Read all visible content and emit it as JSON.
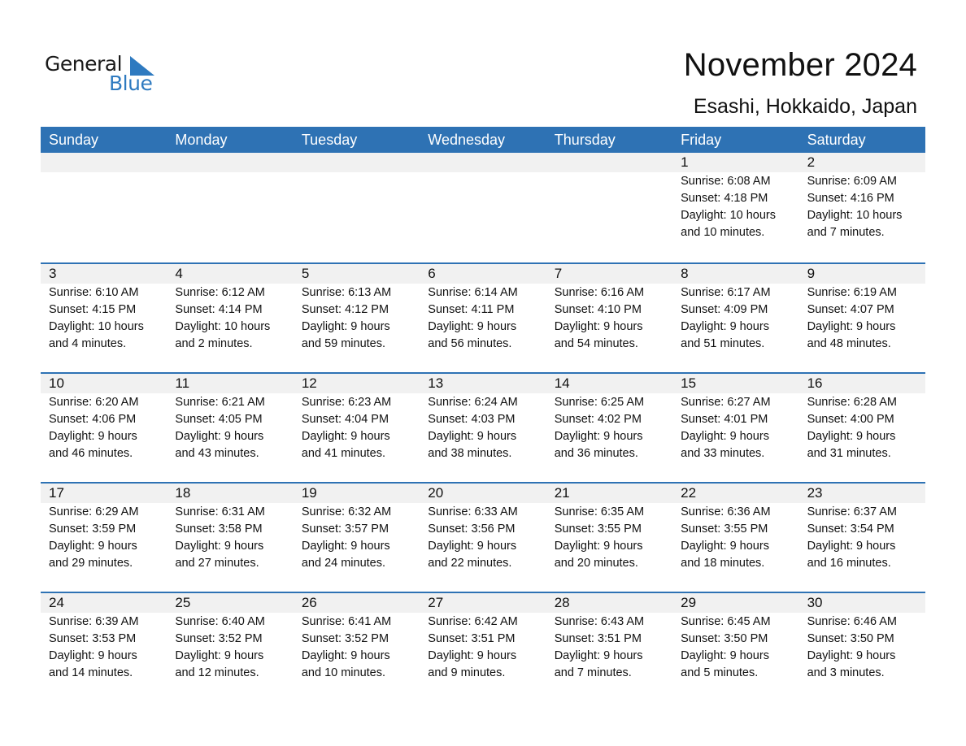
{
  "logo": {
    "line1": "General",
    "line2": "Blue",
    "icon": "triangle-flag-icon",
    "brand_color": "#2e7ac0"
  },
  "header": {
    "title": "November 2024",
    "location": "Esashi, Hokkaido, Japan"
  },
  "colors": {
    "header_bg": "#2e72b4",
    "date_band_bg": "#f1f1f1"
  },
  "weekdays": [
    "Sunday",
    "Monday",
    "Tuesday",
    "Wednesday",
    "Thursday",
    "Friday",
    "Saturday"
  ],
  "weeks": [
    [
      null,
      null,
      null,
      null,
      null,
      {
        "day": "1",
        "sunrise": "Sunrise: 6:08 AM",
        "sunset": "Sunset: 4:18 PM",
        "daylight1": "Daylight: 10 hours",
        "daylight2": "and 10 minutes."
      },
      {
        "day": "2",
        "sunrise": "Sunrise: 6:09 AM",
        "sunset": "Sunset: 4:16 PM",
        "daylight1": "Daylight: 10 hours",
        "daylight2": "and 7 minutes."
      }
    ],
    [
      {
        "day": "3",
        "sunrise": "Sunrise: 6:10 AM",
        "sunset": "Sunset: 4:15 PM",
        "daylight1": "Daylight: 10 hours",
        "daylight2": "and 4 minutes."
      },
      {
        "day": "4",
        "sunrise": "Sunrise: 6:12 AM",
        "sunset": "Sunset: 4:14 PM",
        "daylight1": "Daylight: 10 hours",
        "daylight2": "and 2 minutes."
      },
      {
        "day": "5",
        "sunrise": "Sunrise: 6:13 AM",
        "sunset": "Sunset: 4:12 PM",
        "daylight1": "Daylight: 9 hours",
        "daylight2": "and 59 minutes."
      },
      {
        "day": "6",
        "sunrise": "Sunrise: 6:14 AM",
        "sunset": "Sunset: 4:11 PM",
        "daylight1": "Daylight: 9 hours",
        "daylight2": "and 56 minutes."
      },
      {
        "day": "7",
        "sunrise": "Sunrise: 6:16 AM",
        "sunset": "Sunset: 4:10 PM",
        "daylight1": "Daylight: 9 hours",
        "daylight2": "and 54 minutes."
      },
      {
        "day": "8",
        "sunrise": "Sunrise: 6:17 AM",
        "sunset": "Sunset: 4:09 PM",
        "daylight1": "Daylight: 9 hours",
        "daylight2": "and 51 minutes."
      },
      {
        "day": "9",
        "sunrise": "Sunrise: 6:19 AM",
        "sunset": "Sunset: 4:07 PM",
        "daylight1": "Daylight: 9 hours",
        "daylight2": "and 48 minutes."
      }
    ],
    [
      {
        "day": "10",
        "sunrise": "Sunrise: 6:20 AM",
        "sunset": "Sunset: 4:06 PM",
        "daylight1": "Daylight: 9 hours",
        "daylight2": "and 46 minutes."
      },
      {
        "day": "11",
        "sunrise": "Sunrise: 6:21 AM",
        "sunset": "Sunset: 4:05 PM",
        "daylight1": "Daylight: 9 hours",
        "daylight2": "and 43 minutes."
      },
      {
        "day": "12",
        "sunrise": "Sunrise: 6:23 AM",
        "sunset": "Sunset: 4:04 PM",
        "daylight1": "Daylight: 9 hours",
        "daylight2": "and 41 minutes."
      },
      {
        "day": "13",
        "sunrise": "Sunrise: 6:24 AM",
        "sunset": "Sunset: 4:03 PM",
        "daylight1": "Daylight: 9 hours",
        "daylight2": "and 38 minutes."
      },
      {
        "day": "14",
        "sunrise": "Sunrise: 6:25 AM",
        "sunset": "Sunset: 4:02 PM",
        "daylight1": "Daylight: 9 hours",
        "daylight2": "and 36 minutes."
      },
      {
        "day": "15",
        "sunrise": "Sunrise: 6:27 AM",
        "sunset": "Sunset: 4:01 PM",
        "daylight1": "Daylight: 9 hours",
        "daylight2": "and 33 minutes."
      },
      {
        "day": "16",
        "sunrise": "Sunrise: 6:28 AM",
        "sunset": "Sunset: 4:00 PM",
        "daylight1": "Daylight: 9 hours",
        "daylight2": "and 31 minutes."
      }
    ],
    [
      {
        "day": "17",
        "sunrise": "Sunrise: 6:29 AM",
        "sunset": "Sunset: 3:59 PM",
        "daylight1": "Daylight: 9 hours",
        "daylight2": "and 29 minutes."
      },
      {
        "day": "18",
        "sunrise": "Sunrise: 6:31 AM",
        "sunset": "Sunset: 3:58 PM",
        "daylight1": "Daylight: 9 hours",
        "daylight2": "and 27 minutes."
      },
      {
        "day": "19",
        "sunrise": "Sunrise: 6:32 AM",
        "sunset": "Sunset: 3:57 PM",
        "daylight1": "Daylight: 9 hours",
        "daylight2": "and 24 minutes."
      },
      {
        "day": "20",
        "sunrise": "Sunrise: 6:33 AM",
        "sunset": "Sunset: 3:56 PM",
        "daylight1": "Daylight: 9 hours",
        "daylight2": "and 22 minutes."
      },
      {
        "day": "21",
        "sunrise": "Sunrise: 6:35 AM",
        "sunset": "Sunset: 3:55 PM",
        "daylight1": "Daylight: 9 hours",
        "daylight2": "and 20 minutes."
      },
      {
        "day": "22",
        "sunrise": "Sunrise: 6:36 AM",
        "sunset": "Sunset: 3:55 PM",
        "daylight1": "Daylight: 9 hours",
        "daylight2": "and 18 minutes."
      },
      {
        "day": "23",
        "sunrise": "Sunrise: 6:37 AM",
        "sunset": "Sunset: 3:54 PM",
        "daylight1": "Daylight: 9 hours",
        "daylight2": "and 16 minutes."
      }
    ],
    [
      {
        "day": "24",
        "sunrise": "Sunrise: 6:39 AM",
        "sunset": "Sunset: 3:53 PM",
        "daylight1": "Daylight: 9 hours",
        "daylight2": "and 14 minutes."
      },
      {
        "day": "25",
        "sunrise": "Sunrise: 6:40 AM",
        "sunset": "Sunset: 3:52 PM",
        "daylight1": "Daylight: 9 hours",
        "daylight2": "and 12 minutes."
      },
      {
        "day": "26",
        "sunrise": "Sunrise: 6:41 AM",
        "sunset": "Sunset: 3:52 PM",
        "daylight1": "Daylight: 9 hours",
        "daylight2": "and 10 minutes."
      },
      {
        "day": "27",
        "sunrise": "Sunrise: 6:42 AM",
        "sunset": "Sunset: 3:51 PM",
        "daylight1": "Daylight: 9 hours",
        "daylight2": "and 9 minutes."
      },
      {
        "day": "28",
        "sunrise": "Sunrise: 6:43 AM",
        "sunset": "Sunset: 3:51 PM",
        "daylight1": "Daylight: 9 hours",
        "daylight2": "and 7 minutes."
      },
      {
        "day": "29",
        "sunrise": "Sunrise: 6:45 AM",
        "sunset": "Sunset: 3:50 PM",
        "daylight1": "Daylight: 9 hours",
        "daylight2": "and 5 minutes."
      },
      {
        "day": "30",
        "sunrise": "Sunrise: 6:46 AM",
        "sunset": "Sunset: 3:50 PM",
        "daylight1": "Daylight: 9 hours",
        "daylight2": "and 3 minutes."
      }
    ]
  ]
}
